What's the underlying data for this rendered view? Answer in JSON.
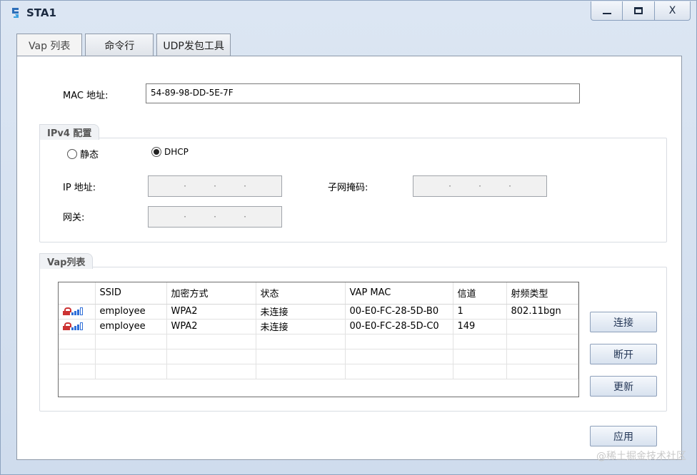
{
  "window": {
    "title": "STA1"
  },
  "tabs": [
    "Vap 列表",
    "命令行",
    "UDP发包工具"
  ],
  "mac": {
    "label": "MAC 地址:",
    "value": "54-89-98-DD-5E-7F"
  },
  "ipv4": {
    "group_title": "IPv4 配置",
    "static_label": "静态",
    "dhcp_label": "DHCP",
    "selected": "DHCP",
    "ip_label": "IP 地址:",
    "mask_label": "子网掩码:",
    "gateway_label": "网关:"
  },
  "vap": {
    "group_title": "Vap列表",
    "columns": [
      "SSID",
      "加密方式",
      "状态",
      "VAP MAC",
      "信道",
      "射频类型"
    ],
    "rows": [
      {
        "ssid": "employee",
        "enc": "WPA2",
        "status": "未连接",
        "mac": "00-E0-FC-28-5D-B0",
        "channel": "1",
        "radio": "802.11bgn"
      },
      {
        "ssid": "employee",
        "enc": "WPA2",
        "status": "未连接",
        "mac": "00-E0-FC-28-5D-C0",
        "channel": "149",
        "radio": ""
      }
    ]
  },
  "buttons": {
    "connect": "连接",
    "disconnect": "断开",
    "refresh": "更新",
    "apply": "应用"
  },
  "watermark": "@稀土掘金技术社区"
}
